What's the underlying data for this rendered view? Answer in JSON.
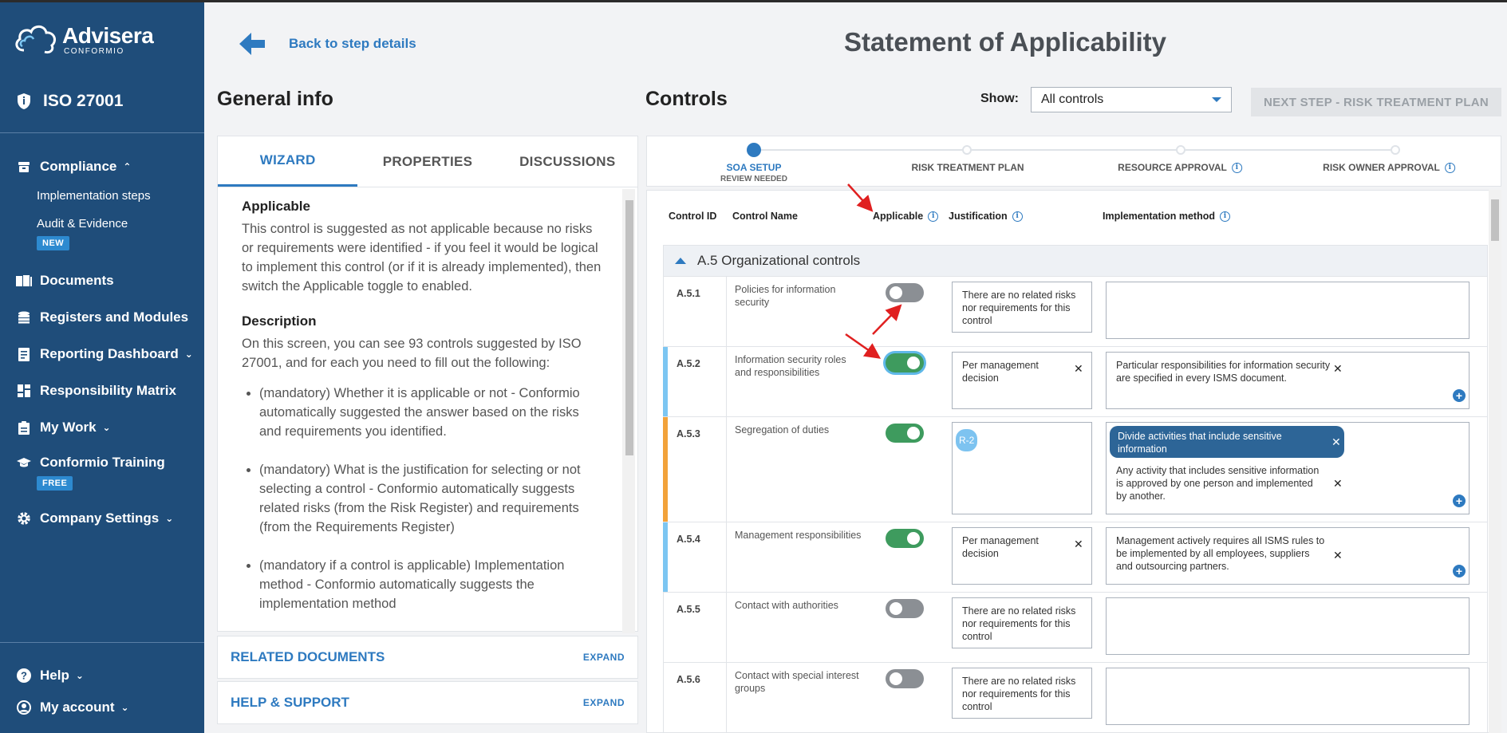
{
  "brand": {
    "name": "Advisera",
    "sub": "CONFORMIO"
  },
  "standard": "ISO 27001",
  "sidebar": {
    "items": [
      {
        "label": "Compliance",
        "icon": "compliance-icon"
      },
      {
        "label": "Implementation steps"
      },
      {
        "label": "Audit & Evidence",
        "badge": "NEW"
      },
      {
        "label": "Documents",
        "icon": "documents-icon"
      },
      {
        "label": "Registers and Modules",
        "icon": "registers-icon"
      },
      {
        "label": "Reporting Dashboard",
        "icon": "reporting-icon"
      },
      {
        "label": "Responsibility Matrix",
        "icon": "matrix-icon"
      },
      {
        "label": "My Work",
        "icon": "mywork-icon"
      },
      {
        "label": "Conformio Training",
        "icon": "training-icon",
        "badge": "FREE"
      },
      {
        "label": "Company Settings",
        "icon": "settings-icon"
      }
    ],
    "bottom": [
      {
        "label": "Help",
        "icon": "help-icon"
      },
      {
        "label": "My account",
        "icon": "account-icon"
      }
    ]
  },
  "header": {
    "back_label": "Back to step details",
    "title": "Statement of Applicability"
  },
  "general_info": {
    "title": "General info",
    "tabs": [
      "WIZARD",
      "PROPERTIES",
      "DISCUSSIONS"
    ],
    "applicable_heading": "Applicable",
    "applicable_text": "This control is suggested as not applicable because no risks or requirements were identified - if you feel it would be logical to implement this control (or if it is already implemented), then switch the Applicable toggle to enabled.",
    "description_heading": "Description",
    "description_text": "On this screen, you can see 93 controls suggested by ISO 27001, and for each you need to fill out the following:",
    "bullets": [
      "(mandatory) Whether it is applicable or not - Conformio automatically suggested the answer based on the risks and requirements you identified.",
      "(mandatory) What is the justification for selecting or not selecting a control - Conformio automatically suggests related risks (from the Risk Register) and requirements (from the Requirements Register)",
      "(mandatory if a control is applicable) Implementation method - Conformio automatically suggests the implementation method"
    ],
    "related_documents": "RELATED DOCUMENTS",
    "help_support": "HELP & SUPPORT",
    "expand": "EXPAND"
  },
  "controls": {
    "title": "Controls",
    "show_label": "Show:",
    "show_value": "All controls",
    "next_button": "NEXT STEP - RISK TREATMENT PLAN",
    "steps": [
      {
        "label": "SOA SETUP",
        "sub": "REVIEW NEEDED",
        "active": true
      },
      {
        "label": "RISK TREATMENT PLAN"
      },
      {
        "label": "RESOURCE APPROVAL",
        "info": true
      },
      {
        "label": "RISK OWNER APPROVAL",
        "info": true
      }
    ],
    "columns": [
      "Control ID",
      "Control Name",
      "Applicable",
      "Justification",
      "Implementation method"
    ],
    "group": "A.5 Organizational controls",
    "rows": [
      {
        "id": "A.5.1",
        "name": "Policies for information security",
        "applicable": false,
        "justification": "There are no related risks nor requirements for this control",
        "implementation": ""
      },
      {
        "id": "A.5.2",
        "name": "Information security roles and responsibilities",
        "applicable": true,
        "justification": "Per management decision",
        "implementation": "Particular responsibilities for information security are specified in every ISMS document.",
        "accent": "#7cc6f2"
      },
      {
        "id": "A.5.3",
        "name": "Segregation of duties",
        "applicable": true,
        "justification_chip": "R-2",
        "implementation_pill": "Divide activities that include sensitive information",
        "implementation": "Any activity that includes sensitive information is approved by one person and implemented by another.",
        "accent": "#f2a23a"
      },
      {
        "id": "A.5.4",
        "name": "Management responsibilities",
        "applicable": true,
        "justification": "Per management decision",
        "implementation": "Management actively requires all ISMS rules to be implemented by all employees, suppliers and outsourcing partners.",
        "accent": "#7cc6f2"
      },
      {
        "id": "A.5.5",
        "name": "Contact with authorities",
        "applicable": false,
        "justification": "There are no related risks nor requirements for this control",
        "implementation": ""
      },
      {
        "id": "A.5.6",
        "name": "Contact with special interest groups",
        "applicable": false,
        "justification": "There are no related risks nor requirements for this control",
        "implementation": ""
      }
    ]
  },
  "colors": {
    "sidebar": "#1f4d7a",
    "accent": "#2e7ac0",
    "toggle_on": "#3e9b5e",
    "toggle_off": "#8b8f94",
    "annotation": "#e02020"
  }
}
